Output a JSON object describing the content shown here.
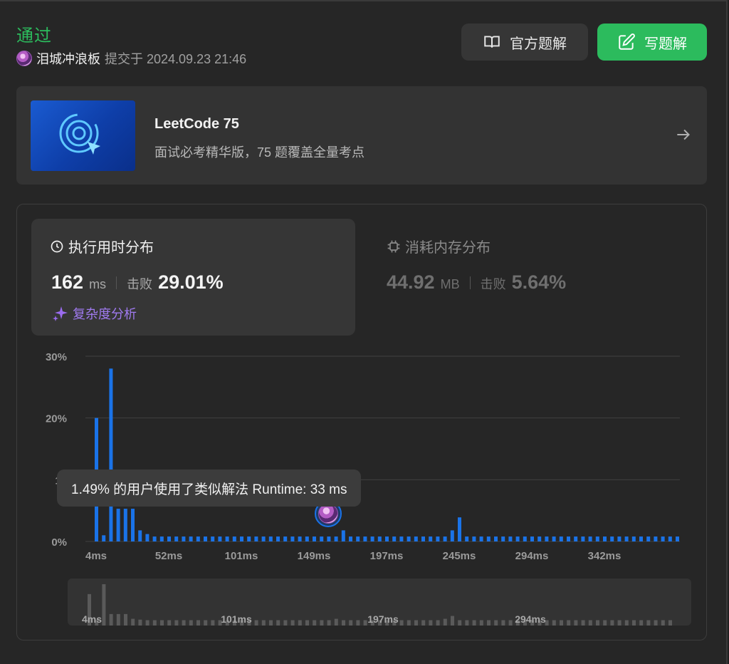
{
  "header": {
    "status": "通过",
    "username": "泪城冲浪板",
    "submitted_at": "提交于 2024.09.23 21:46",
    "official_solution_label": "官方题解",
    "write_solution_label": "写题解"
  },
  "banner": {
    "title": "LeetCode 75",
    "description": "面试必考精华版，75 题覆盖全量考点"
  },
  "runtime": {
    "title": "执行用时分布",
    "value": "162",
    "unit": "ms",
    "beat_label": "击败",
    "beat_percent": "29.01%",
    "complexity_label": "复杂度分析"
  },
  "memory": {
    "title": "消耗内存分布",
    "value": "44.92",
    "unit": "MB",
    "beat_label": "击败",
    "beat_percent": "5.64%"
  },
  "tooltip": "1.49% 的用户使用了类似解法 Runtime: 33 ms",
  "colors": {
    "accent_green": "#2cbb5d",
    "bar_blue": "#1a73e8",
    "purple": "#a07af0"
  },
  "chart_data": {
    "type": "bar",
    "ylabel_ticks": [
      "30%",
      "20%",
      "10",
      "0%"
    ],
    "ylim": [
      0,
      30
    ],
    "x_tick_labels": [
      "4ms",
      "52ms",
      "101ms",
      "149ms",
      "197ms",
      "245ms",
      "294ms",
      "342ms"
    ],
    "values": [
      20,
      1,
      28,
      5.3,
      5.3,
      5.3,
      1.8,
      1.2,
      0.8,
      0.8,
      0.8,
      0.8,
      0.8,
      0.8,
      0.8,
      0.8,
      0.8,
      0.8,
      0.8,
      0.8,
      0.8,
      0.8,
      0.8,
      0.8,
      0.8,
      0.8,
      0.8,
      0.8,
      0.8,
      0.8,
      0.8,
      0.8,
      0.8,
      0.8,
      0.8,
      0.8,
      0.8,
      0.8,
      0.8,
      0.8,
      0.8,
      0.8,
      0.8,
      0.8,
      0.8,
      0.8,
      0.8,
      0.8,
      0.8,
      0.8,
      0.8,
      0.8,
      0.8,
      0.8,
      0.8,
      0.8,
      0.8,
      0.8,
      0.8,
      0.8,
      0.8,
      0.8,
      0.8,
      0.8,
      0.8,
      0.8,
      0.8,
      0.8,
      0.8,
      0.8,
      0.8,
      0.8,
      0.8,
      0.8,
      0.8,
      0.8,
      0.8,
      0.8,
      0.8,
      0.8,
      0.8
    ],
    "highlight_values": {
      "34": 1.8,
      "49": 1.8,
      "50": 3.9
    },
    "navigator_tick_labels": [
      "4ms",
      "101ms",
      "197ms",
      "294ms"
    ],
    "grid": true
  }
}
